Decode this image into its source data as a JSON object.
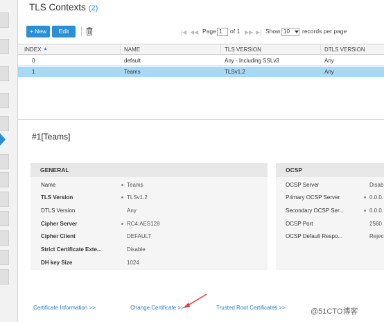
{
  "page": {
    "title": "TLS Contexts",
    "count": "(2)"
  },
  "toolbar": {
    "new_label": "+ New",
    "edit_label": "Edit",
    "delete_icon": "trash-icon"
  },
  "pager": {
    "page_label": "Page",
    "page_value": "1",
    "of_label": "of 1",
    "show_label": "Show",
    "per_page_value": "10",
    "records_label": "records per page",
    "first_icon": "|◀",
    "prev_icon": "◀◀",
    "next_icon": "▶▶",
    "last_icon": "▶|"
  },
  "table": {
    "columns": [
      "INDEX",
      "NAME",
      "TLS VERSION",
      "DTLS VERSION"
    ],
    "rows": [
      [
        "0",
        "default",
        "Any - Including SSLv3",
        "Any"
      ],
      [
        "1",
        "Teams",
        "TLSv1.2",
        "Any"
      ]
    ],
    "selected_row": 1
  },
  "detail": {
    "title": "#1[Teams]",
    "general": {
      "header": "GENERAL",
      "fields": [
        {
          "label": "Name",
          "value": "Teams"
        },
        {
          "label": "TLS Version",
          "value": "TLSv1.2"
        },
        {
          "label": "DTLS Version",
          "value": "Any"
        },
        {
          "label": "Cipher Server",
          "value": "RC4:AES128"
        },
        {
          "label": "Cipher Client",
          "value": "DEFAULT"
        },
        {
          "label": "Strict Certificate Exte...",
          "value": "Disable"
        },
        {
          "label": "DH key Size",
          "value": "1024"
        }
      ]
    },
    "ocsp": {
      "header": "OCSP",
      "fields": [
        {
          "label": "OCSP Server",
          "value": "Disab"
        },
        {
          "label": "Primary OCSP Server",
          "value": "0.0.0."
        },
        {
          "label": "Secondary OCSP Ser...",
          "value": "0.0.0."
        },
        {
          "label": "OCSP Port",
          "value": "2560"
        },
        {
          "label": "OCSP Default Respo...",
          "value": "Rejec"
        }
      ]
    }
  },
  "links": {
    "cert_info": "Certificate Information >>",
    "change_cert": "Change Certificate >>",
    "trusted_root": "Trusted Root Certificates >>"
  },
  "watermark": "@51CTO博客",
  "colors": {
    "accent": "#2b8fd6",
    "selected_row": "#a8d8f2",
    "annotation_arrow": "#e53935"
  }
}
